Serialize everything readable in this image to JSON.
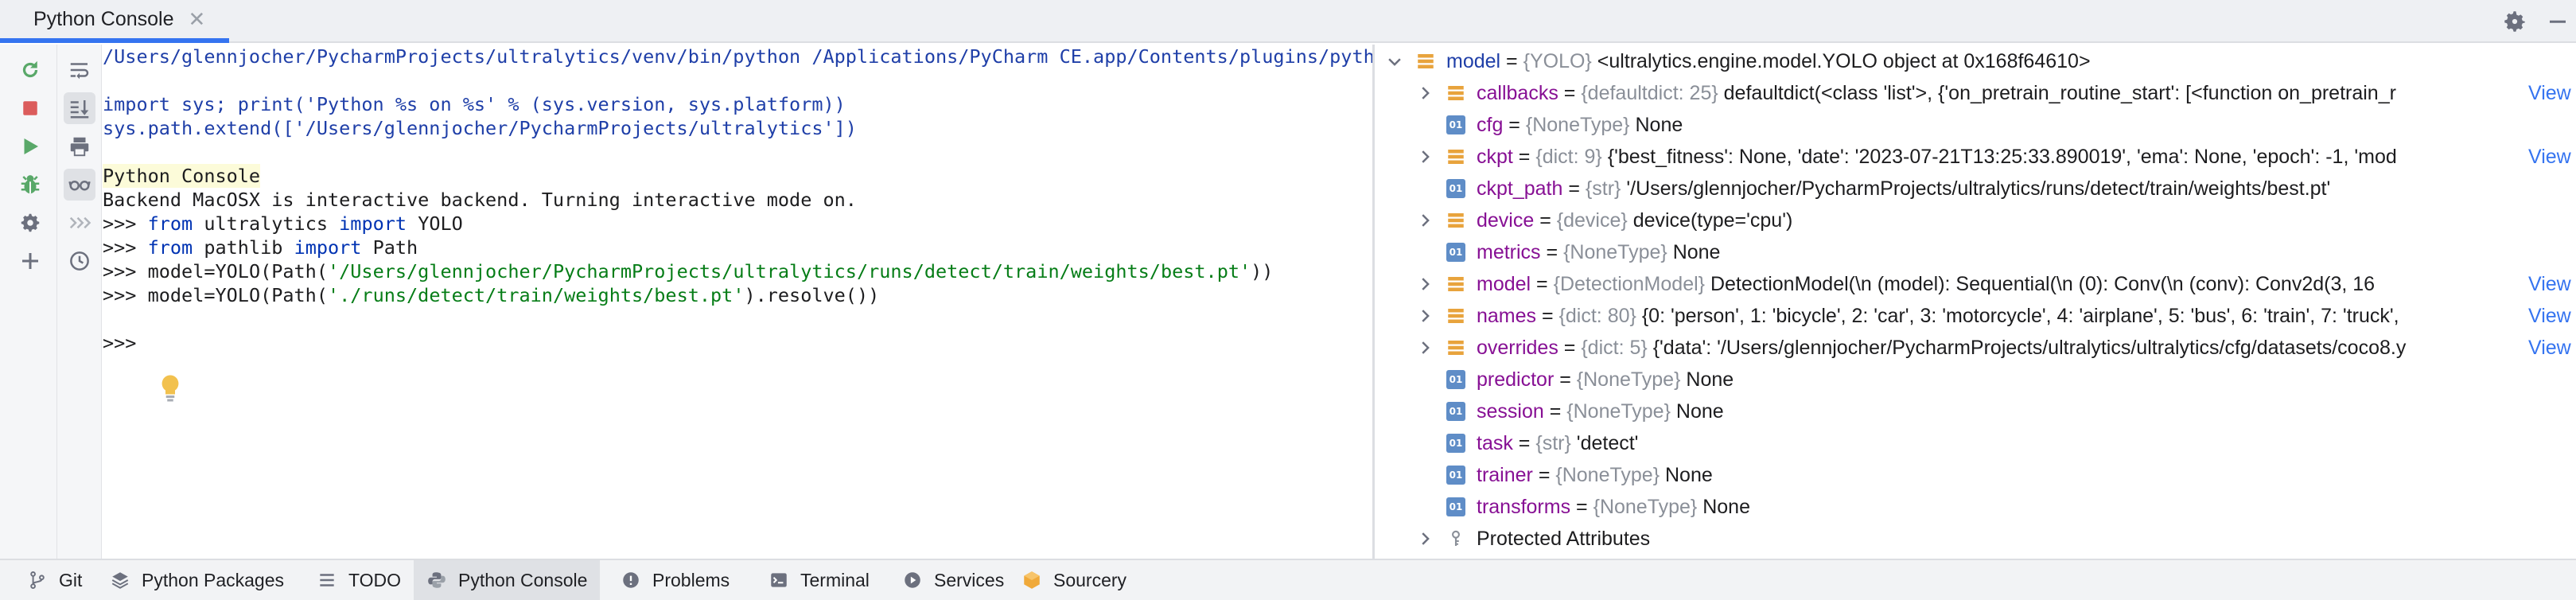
{
  "tab": {
    "label": "Python Console",
    "close": "✕"
  },
  "console": {
    "lines": [
      "/Users/glennjocher/PycharmProjects/ultralytics/venv/bin/python /Applications/PyCharm CE.app/Contents/plugins/pyth",
      "",
      "import sys; print('Python %s on %s' % (sys.version, sys.platform))",
      "sys.path.extend(['/Users/glennjocher/PycharmProjects/ultralytics'])",
      "",
      "Python Console",
      "Backend MacOSX is interactive backend. Turning interactive mode on.",
      ">>> from ultralytics import YOLO",
      ">>> from pathlib import Path",
      ">>> model=YOLO(Path('/Users/glennjocher/PycharmProjects/ultralytics/runs/detect/train/weights/best.pt'))",
      ">>> model=YOLO(Path('./runs/detect/train/weights/best.pt').resolve())",
      "",
      ">>>"
    ],
    "header": "Python Console",
    "prompt": ">>>",
    "kw_from": "from",
    "kw_import": "import",
    "mod_ultralytics": "ultralytics",
    "cls_yolo": "YOLO",
    "mod_pathlib": "pathlib",
    "cls_path": "Path",
    "code_model_open": "model=YOLO(Path(",
    "str_abs": "'/Users/glennjocher/PycharmProjects/ultralytics/runs/detect/train/weights/best.pt'",
    "code_close1": "))",
    "str_rel": "'./runs/detect/train/weights/best.pt'",
    "code_close2": ").resolve())"
  },
  "variables": {
    "view_label": "View",
    "rows": [
      {
        "name": "model",
        "type": "{YOLO}",
        "value": "<ultralytics.engine.model.YOLO object at 0x168f64610>",
        "icon": "object-icon",
        "expanded": true,
        "root": true,
        "view": false
      },
      {
        "name": "callbacks",
        "type": "{defaultdict: 25}",
        "value": "defaultdict(<class 'list'>, {'on_pretrain_routine_start': [<function on_pretrain_r",
        "icon": "object-icon",
        "expandable": true,
        "view": true
      },
      {
        "name": "cfg",
        "type": "{NoneType}",
        "value": "None",
        "icon": "01-icon",
        "expandable": false,
        "view": false
      },
      {
        "name": "ckpt",
        "type": "{dict: 9}",
        "value": "{'best_fitness': None, 'date': '2023-07-21T13:25:33.890019', 'ema': None, 'epoch': -1, 'mod",
        "icon": "object-icon",
        "expandable": true,
        "view": true
      },
      {
        "name": "ckpt_path",
        "type": "{str}",
        "value": "'/Users/glennjocher/PycharmProjects/ultralytics/runs/detect/train/weights/best.pt'",
        "icon": "01-icon",
        "expandable": false,
        "view": false
      },
      {
        "name": "device",
        "type": "{device}",
        "value": "device(type='cpu')",
        "icon": "object-icon",
        "expandable": true,
        "view": false
      },
      {
        "name": "metrics",
        "type": "{NoneType}",
        "value": "None",
        "icon": "01-icon",
        "expandable": false,
        "view": false
      },
      {
        "name": "model",
        "type": "{DetectionModel}",
        "value": "DetectionModel(\\n  (model): Sequential(\\n    (0): Conv(\\n      (conv): Conv2d(3, 16",
        "icon": "object-icon",
        "expandable": true,
        "view": true
      },
      {
        "name": "names",
        "type": "{dict: 80}",
        "value": "{0: 'person', 1: 'bicycle', 2: 'car', 3: 'motorcycle', 4: 'airplane', 5: 'bus', 6: 'train', 7: 'truck',",
        "icon": "object-icon",
        "expandable": true,
        "view": true
      },
      {
        "name": "overrides",
        "type": "{dict: 5}",
        "value": "{'data': '/Users/glennjocher/PycharmProjects/ultralytics/ultralytics/cfg/datasets/coco8.y",
        "icon": "object-icon",
        "expandable": true,
        "view": true
      },
      {
        "name": "predictor",
        "type": "{NoneType}",
        "value": "None",
        "icon": "01-icon",
        "expandable": false,
        "view": false
      },
      {
        "name": "session",
        "type": "{NoneType}",
        "value": "None",
        "icon": "01-icon",
        "expandable": false,
        "view": false
      },
      {
        "name": "task",
        "type": "{str}",
        "value": "'detect'",
        "icon": "01-icon",
        "expandable": false,
        "view": false
      },
      {
        "name": "trainer",
        "type": "{NoneType}",
        "value": "None",
        "icon": "01-icon",
        "expandable": false,
        "view": false
      },
      {
        "name": "transforms",
        "type": "{NoneType}",
        "value": "None",
        "icon": "01-icon",
        "expandable": false,
        "view": false
      },
      {
        "name": "Protected Attributes",
        "type": "",
        "value": "",
        "icon": "key-icon",
        "expandable": true,
        "view": false,
        "plain": true
      }
    ]
  },
  "bottom_bar": {
    "items": [
      {
        "label": "Git",
        "icon": "git-branch-icon",
        "active": false
      },
      {
        "label": "Python Packages",
        "icon": "layers-icon",
        "active": false
      },
      {
        "label": "TODO",
        "icon": "list-icon",
        "active": false
      },
      {
        "label": "Python Console",
        "icon": "python-console-icon",
        "active": true
      },
      {
        "label": "Problems",
        "icon": "problems-icon",
        "active": false
      },
      {
        "label": "Terminal",
        "icon": "terminal-icon",
        "active": false
      },
      {
        "label": "Services",
        "icon": "services-icon",
        "active": false
      },
      {
        "label": "Sourcery",
        "icon": "sourcery-icon",
        "active": false
      }
    ]
  },
  "colors": {
    "accent": "#3574f0",
    "keyword": "#0033b3",
    "string": "#067d17",
    "var_name": "#871094",
    "type_gray": "#8a8f98",
    "rerun_green": "#59a869",
    "stop_red": "#db5c5c",
    "object_orange": "#e8a33c"
  }
}
